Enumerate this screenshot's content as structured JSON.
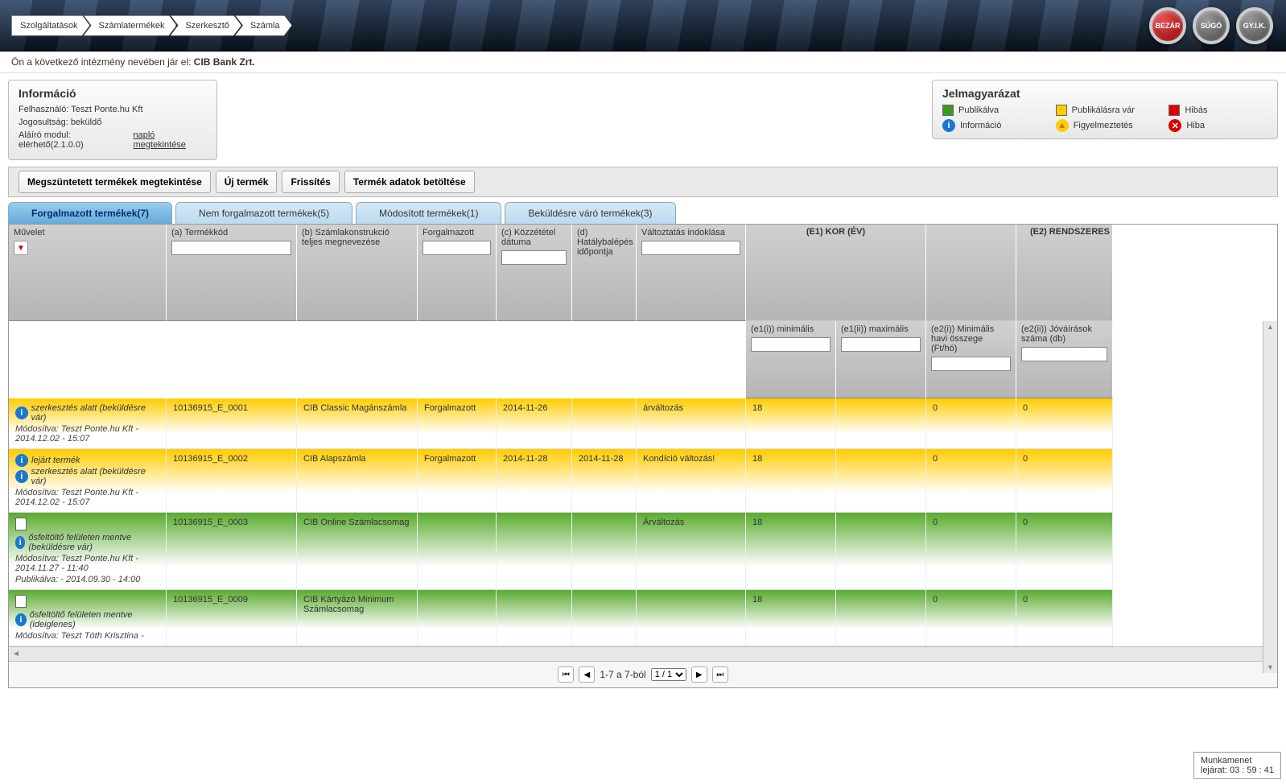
{
  "breadcrumb": [
    "Szolgáltatások",
    "Számlatermékek",
    "Szerkesztő",
    "Számla"
  ],
  "roundButtons": {
    "close": "BEZÁR",
    "help": "SÚGÓ",
    "faq": "GY.I.K."
  },
  "institutionLine": {
    "prefix": "Ön a következő intézmény nevében jár el: ",
    "name": "CIB Bank Zrt."
  },
  "infoPanel": {
    "title": "Információ",
    "user_label": "Felhasználó: Teszt Ponte.hu Kft",
    "perm_label": "Jogosultság: beküldő",
    "signer_label": "Aláíró modul: elérhető(2.1.0.0)",
    "log_link": "napló megtekintése"
  },
  "legendPanel": {
    "title": "Jelmagyarázat",
    "items": {
      "pub": "Publikálva",
      "pend": "Publikálásra vár",
      "err": "Hibás",
      "info": "Információ",
      "warn": "Figyelmeztetés",
      "error": "Hiba"
    }
  },
  "actions": {
    "view_discontinued": "Megszüntetett termékek megtekintése",
    "new_product": "Új termék",
    "refresh": "Frissítés",
    "load_data": "Termék adatok betöltése"
  },
  "tabs": [
    {
      "label": "Forgalmazott termékek(7)",
      "active": true
    },
    {
      "label": "Nem forgalmazott termékek(5)"
    },
    {
      "label": "Módosított termékek(1)"
    },
    {
      "label": "Beküldésre váró termékek(3)"
    }
  ],
  "columns": {
    "op": "Művelet",
    "code": "(a) Termékkód",
    "name": "(b) Számlakonstrukció teljes megnevezése",
    "dist": "Forgalmazott",
    "pub_date": "(c) Közzététel dátuma",
    "eff_date": "(d) Hatálybalépés időpontja",
    "reason": "Változtatás indoklása",
    "group_e1": "(E1) KOR (ÉV)",
    "e1_min": "(e1(i)) minimális",
    "e1_max": "(e1(ii)) maximális",
    "e2_min": "(e2(i)) Minimális havi összege (Ft/hó)",
    "group_e2": "(E2) RENDSZERES",
    "e2_cnt": "(e2(ii)) Jóváírások száma (db)"
  },
  "rows": [
    {
      "color": "yellow",
      "status": [
        {
          "icon": "info",
          "text": "szerkesztés alatt (beküldésre vár)"
        }
      ],
      "mod": "Módosítva: Teszt Ponte.hu Kft - 2014.12.02 - 15:07",
      "code": "10136915_E_0001",
      "name": "CIB Classic Magánszámla",
      "dist": "Forgalmazott",
      "pub_date": "2014-11-26",
      "eff_date": "",
      "reason": "árváltozás",
      "e1min": "18",
      "e1max": "",
      "e2min": "0",
      "e2cnt": "0"
    },
    {
      "color": "yellow",
      "status": [
        {
          "icon": "info",
          "text": "lejárt termék"
        },
        {
          "icon": "info",
          "text": "szerkesztés alatt (beküldésre vár)"
        }
      ],
      "mod": "Módosítva: Teszt Ponte.hu Kft - 2014.12.02 - 15:07",
      "code": "10136915_E_0002",
      "name": "CIB Alapszámla",
      "dist": "Forgalmazott",
      "pub_date": "2014-11-28",
      "eff_date": "2014-11-28",
      "reason": "Kondíció változás!",
      "e1min": "18",
      "e1max": "",
      "e2min": "0",
      "e2cnt": "0"
    },
    {
      "color": "green",
      "doc": true,
      "status": [
        {
          "icon": "info",
          "text": "ősfeltöltő felületen mentve (beküldésre vár)"
        }
      ],
      "mod": "Módosítva: Teszt Ponte.hu Kft - 2014.11.27 - 11:40",
      "pub": "Publikálva: - 2014.09.30 - 14:00",
      "code": "10136915_E_0003",
      "name": "CIB Online Számlacsomag",
      "dist": "",
      "pub_date": "",
      "eff_date": "",
      "reason": "Árváltozás",
      "e1min": "18",
      "e1max": "",
      "e2min": "0",
      "e2cnt": "0"
    },
    {
      "color": "green",
      "doc": true,
      "status": [
        {
          "icon": "info",
          "text": "ősfeltöltő felületen mentve (ideiglenes)"
        }
      ],
      "mod": "Módosítva: Teszt Tóth Krisztina -",
      "code": "10136915_E_0009",
      "name": "CIB Kártyázó Minimum Számlacsomag",
      "dist": "",
      "pub_date": "",
      "eff_date": "",
      "reason": "",
      "e1min": "18",
      "e1max": "",
      "e2min": "0",
      "e2cnt": "0"
    }
  ],
  "pager": {
    "range": "1-7 a 7-ból",
    "page": "1 / 1"
  },
  "session": {
    "label": "Munkamenet",
    "text": "lejárat: 03 : 59 : 41"
  }
}
